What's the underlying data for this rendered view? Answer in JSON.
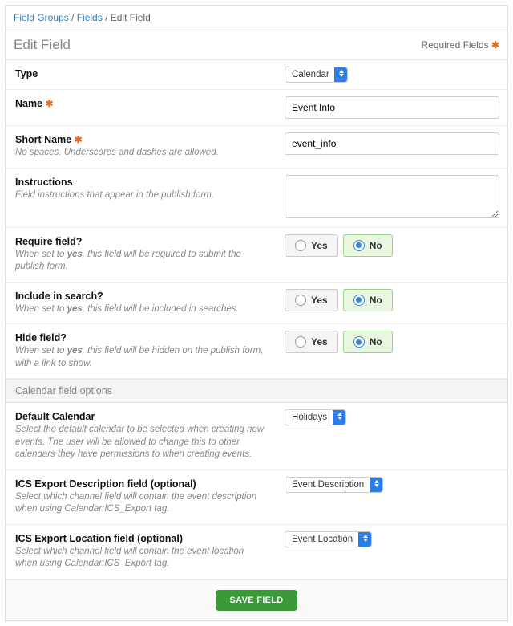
{
  "breadcrumb": {
    "a": "Field Groups",
    "b": "Fields",
    "c": "Edit Field",
    "sep": " / "
  },
  "header": {
    "title": "Edit Field",
    "required": "Required Fields"
  },
  "fields": {
    "type": {
      "label": "Type",
      "value": "Calendar"
    },
    "name": {
      "label": "Name",
      "value": "Event Info"
    },
    "short": {
      "label": "Short Name",
      "hint": "No spaces. Underscores and dashes are allowed.",
      "value": "event_info"
    },
    "instructions": {
      "label": "Instructions",
      "hint": "Field instructions that appear in the publish form.",
      "value": ""
    },
    "require": {
      "label": "Require field?",
      "hint": "When set to <b>yes</b>, this field will be required to submit the publish form.",
      "value": "No"
    },
    "search": {
      "label": "Include in search?",
      "hint": "When set to <b>yes</b>, this field will be included in searches.",
      "value": "No"
    },
    "hide": {
      "label": "Hide field?",
      "hint": "When set to <b>yes</b>, this field will be hidden on the publish form, with a link to show.",
      "value": "No"
    }
  },
  "yesno": {
    "yes": "Yes",
    "no": "No"
  },
  "calendar": {
    "section": "Calendar field options",
    "default_cal": {
      "label": "Default Calendar",
      "hint": "Select the default calendar to be selected when creating new events. The user will be allowed to change this to other calendars they have permissions to when creating events.",
      "value": "Holidays"
    },
    "ics_desc": {
      "label": "ICS Export Description field (optional)",
      "hint": "Select which channel field will contain the event description when using Calendar:ICS_Export tag.",
      "value": "Event Description"
    },
    "ics_loc": {
      "label": "ICS Export Location field (optional)",
      "hint": "Select which channel field will contain the event location when using Calendar:ICS_Export tag.",
      "value": "Event Location"
    }
  },
  "footer": {
    "save": "SAVE FIELD"
  }
}
